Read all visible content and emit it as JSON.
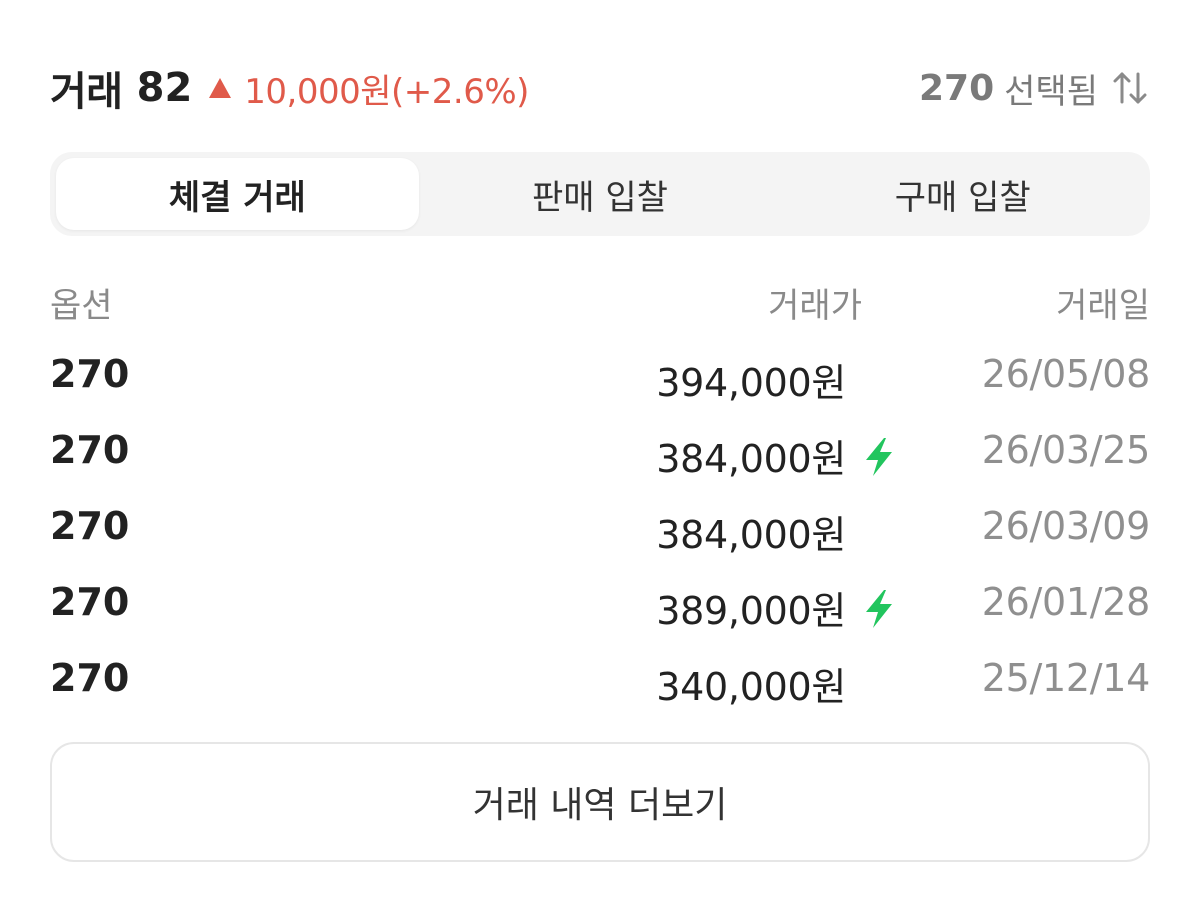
{
  "header": {
    "title": "거래",
    "count": "82",
    "trend_icon": "triangle-up-icon",
    "change": "10,000원(+2.6%)",
    "size": "270",
    "selected_label": "선택됨",
    "sort_icon": "sort-arrows-icon"
  },
  "colors": {
    "up": "#e05a4a",
    "bolt": "#22c55e",
    "muted": "#8f8f8f",
    "text": "#222222"
  },
  "tabs": [
    {
      "label": "체결 거래",
      "active": true
    },
    {
      "label": "판매 입찰",
      "active": false
    },
    {
      "label": "구매 입찰",
      "active": false
    }
  ],
  "table": {
    "columns": {
      "option": "옵션",
      "price": "거래가",
      "date": "거래일"
    },
    "rows": [
      {
        "option": "270",
        "price": "394,000원",
        "fast": false,
        "date": "26/05/08"
      },
      {
        "option": "270",
        "price": "384,000원",
        "fast": true,
        "date": "26/03/25"
      },
      {
        "option": "270",
        "price": "384,000원",
        "fast": false,
        "date": "26/03/09"
      },
      {
        "option": "270",
        "price": "389,000원",
        "fast": true,
        "date": "26/01/28"
      },
      {
        "option": "270",
        "price": "340,000원",
        "fast": false,
        "date": "25/12/14"
      }
    ]
  },
  "more_button": {
    "label": "거래 내역 더보기"
  }
}
